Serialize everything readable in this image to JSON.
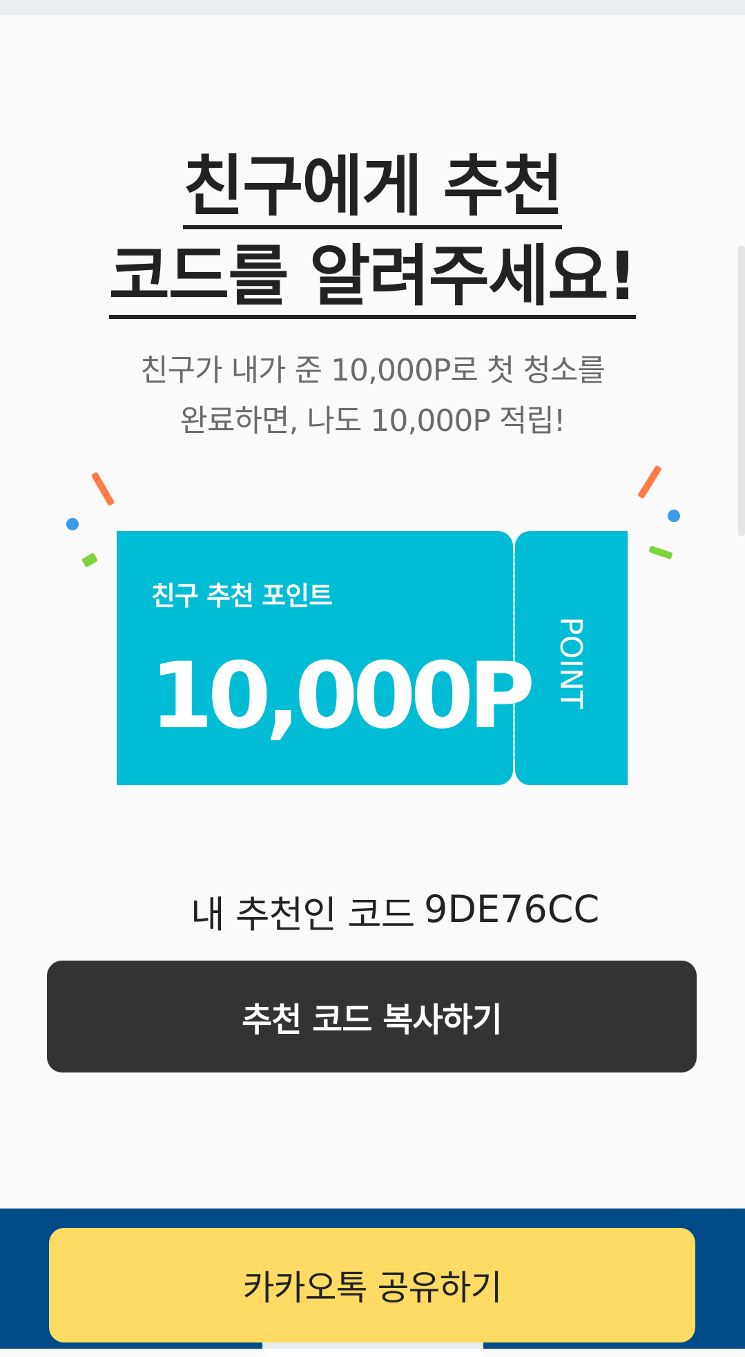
{
  "headline": {
    "line1": "친구에게 추천",
    "line2": "코드를 알려주세요!"
  },
  "description": {
    "line1": "친구가 내가 준 10,000P로 첫 청소를",
    "line2": "완료하면, 나도 10,000P 적립!"
  },
  "ticket": {
    "label": "친구 추천 포인트",
    "amount": "10,000P",
    "stub_text": "POINT"
  },
  "referral": {
    "label": "내 추천인 코드",
    "code": "9DE76CC"
  },
  "buttons": {
    "copy": "추천 코드 복사하기",
    "kakao_share": "카카오톡 공유하기"
  },
  "colors": {
    "ticket": "#00bcd4",
    "copy_button": "#333333",
    "kakao_button": "#ffdb63",
    "bottom_bar": "#004a87",
    "confetti_orange": "#ff7a45",
    "confetti_green": "#7ed33a",
    "confetti_blue": "#3d9ae8"
  }
}
